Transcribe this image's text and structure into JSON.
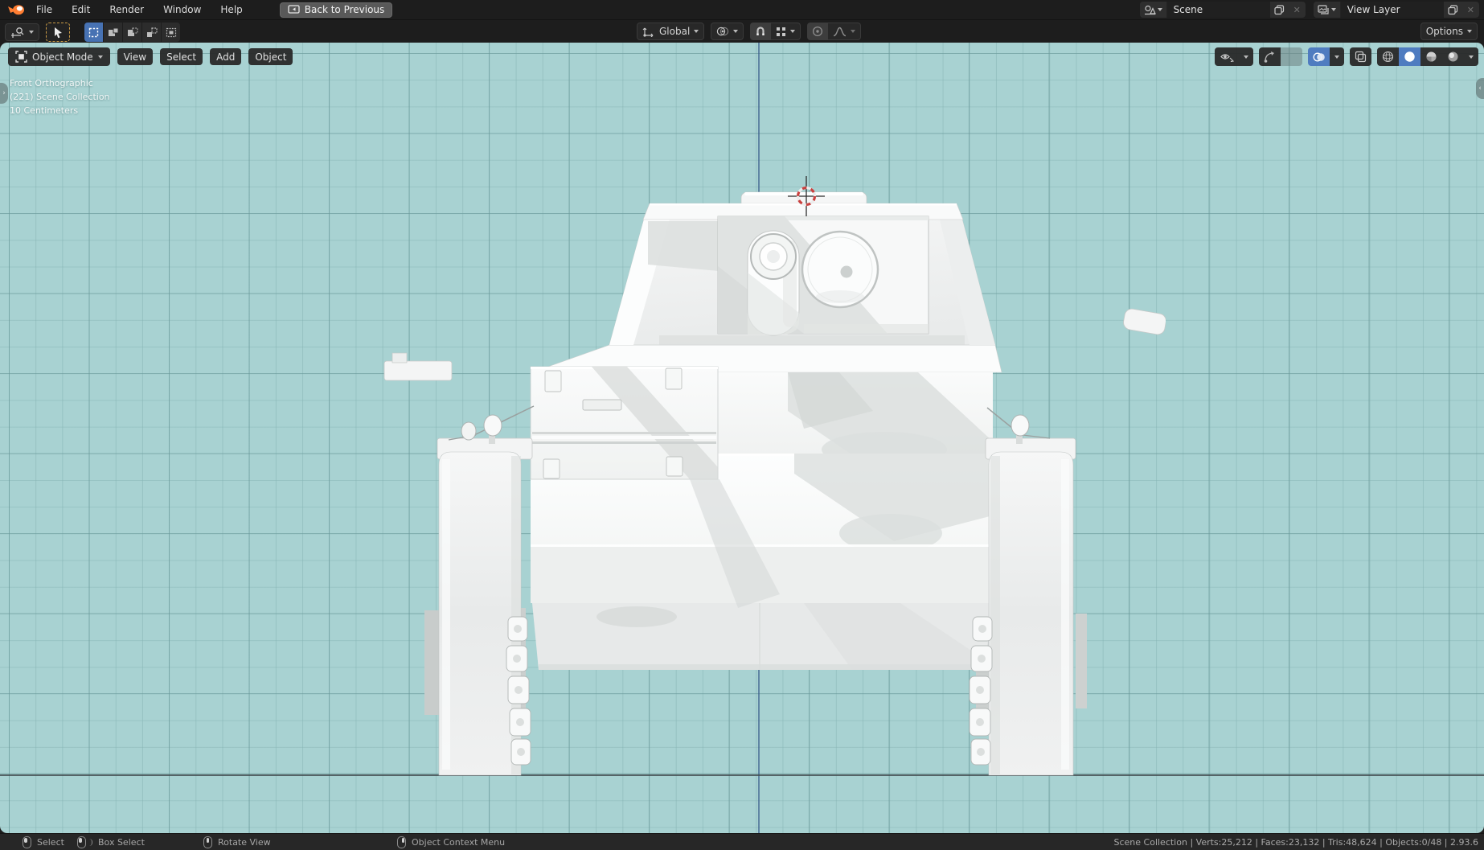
{
  "topbar": {
    "menus": [
      "File",
      "Edit",
      "Render",
      "Window",
      "Help"
    ],
    "back_button": "Back to Previous",
    "scene_selector": {
      "value": "Scene"
    },
    "view_layer_selector": {
      "value": "View Layer"
    },
    "close_glyph": "✕"
  },
  "tool_settings": {
    "orientation": {
      "value": "Global"
    },
    "options_label": "Options"
  },
  "viewport": {
    "header": {
      "mode": "Object Mode",
      "menus": [
        "View",
        "Select",
        "Add",
        "Object"
      ]
    },
    "overlay": {
      "view_label": "Front Orthographic",
      "collection_label": "(221) Scene Collection",
      "scale_label": "10 Centimeters"
    }
  },
  "statusbar": {
    "hints": [
      {
        "icon": "mouse-left",
        "label": "Select"
      },
      {
        "icon": "mouse-left-drag",
        "label": "Box Select"
      },
      {
        "icon": "mouse-middle",
        "label": "Rotate View"
      },
      {
        "icon": "mouse-right",
        "label": "Object Context Menu"
      }
    ],
    "stats": "Scene Collection | Verts:25,212 | Faces:23,132 | Tris:48,624 | Objects:0/48 | 2.93.6"
  },
  "colors": {
    "accent_blue": "#4772b3",
    "header_bg": "#1d1d1d",
    "viewport_bg": "#a8d2d2",
    "grid_major": "#689899",
    "grid_minor": "#84b2b2",
    "axis_z": "#375c8a",
    "back_button_bg": "#595959",
    "tool_active_outline": "#c99a45"
  },
  "icons": [
    "blender-logo",
    "back-screen-icon",
    "scene-icon",
    "view-layer-icon",
    "copy-icon",
    "close-icon",
    "active-tool-icon",
    "tweak-cursor-icon",
    "select-set-icon",
    "select-extend-icon",
    "select-subtract-icon",
    "select-invert-icon",
    "select-intersect-icon",
    "orientation-axes-icon",
    "pivot-point-icon",
    "magnet-icon",
    "snap-target-icon",
    "proportional-edit-icon",
    "falloff-curve-icon",
    "object-mode-icon",
    "visibility-icon",
    "gizmo-icon",
    "overlays-icon",
    "xray-icon",
    "wireframe-shading-icon",
    "solid-shading-icon",
    "material-shading-icon",
    "rendered-shading-icon",
    "mouse-left",
    "mouse-left-drag",
    "mouse-middle",
    "mouse-right",
    "3d-cursor",
    "chevron-down-icon"
  ]
}
